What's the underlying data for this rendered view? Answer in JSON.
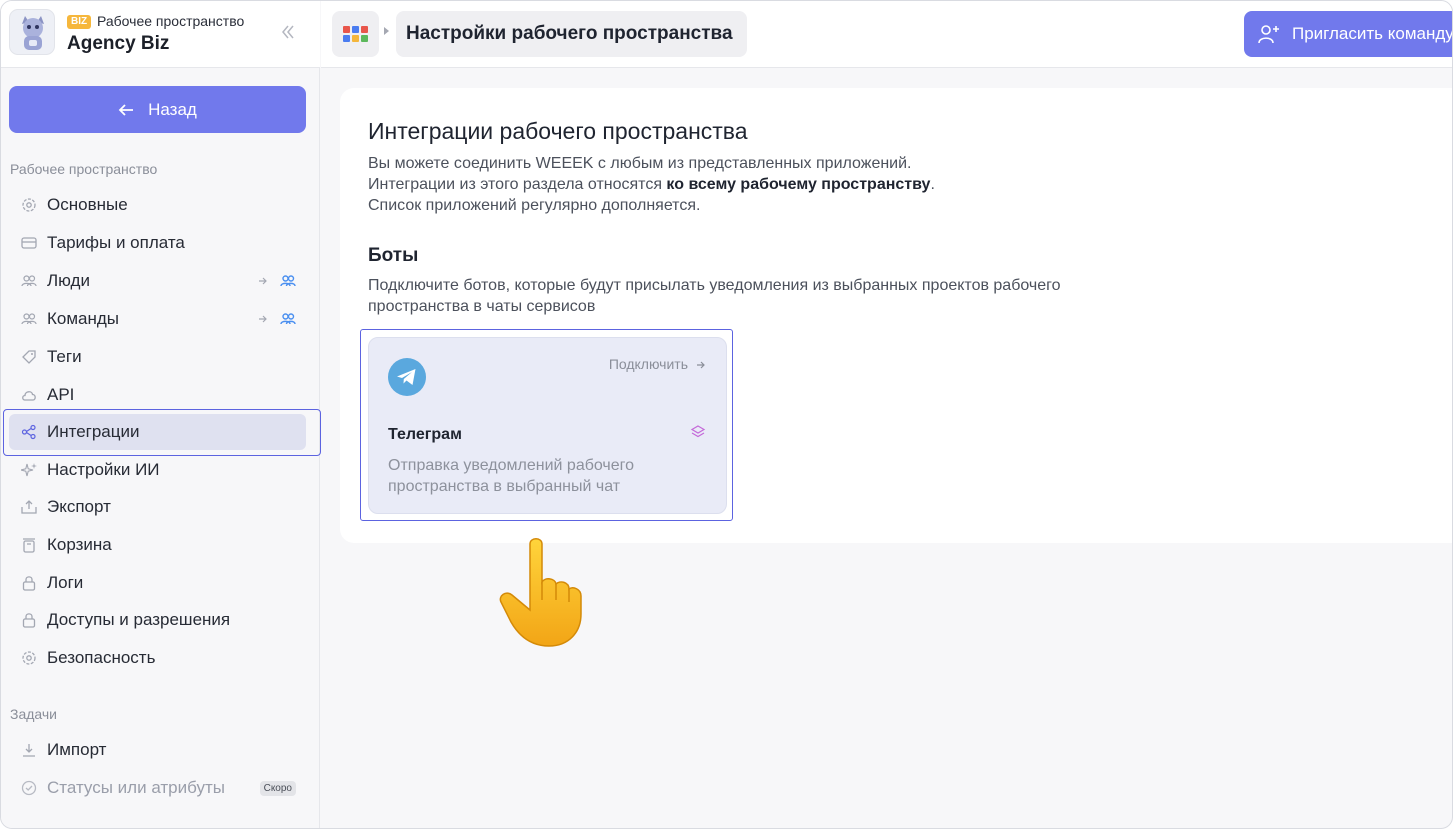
{
  "workspace": {
    "badge": "BIZ",
    "label": "Рабочее пространство",
    "name": "Agency Biz"
  },
  "sidebar": {
    "back_label": "Назад",
    "section_workspace": "Рабочее пространство",
    "workspace_items": [
      {
        "label": "Основные",
        "icon": "gear-icon"
      },
      {
        "label": "Тарифы и оплата",
        "icon": "card-icon"
      },
      {
        "label": "Люди",
        "icon": "people-icon"
      },
      {
        "label": "Команды",
        "icon": "people-icon"
      },
      {
        "label": "Теги",
        "icon": "tag-icon"
      },
      {
        "label": "API",
        "icon": "cloud-icon"
      },
      {
        "label": "Интеграции",
        "icon": "integration-icon"
      },
      {
        "label": "Настройки ИИ",
        "icon": "sparkle-icon"
      },
      {
        "label": "Экспорт",
        "icon": "export-icon"
      },
      {
        "label": "Корзина",
        "icon": "trash-icon"
      },
      {
        "label": "Логи",
        "icon": "lock-icon"
      },
      {
        "label": "Доступы и разрешения",
        "icon": "lock-icon"
      },
      {
        "label": "Безопасность",
        "icon": "gear-icon"
      }
    ],
    "section_tasks": "Задачи",
    "task_items": [
      {
        "label": "Импорт",
        "icon": "download-icon"
      },
      {
        "label": "Статусы или атрибуты",
        "icon": "check-circle-icon",
        "badge": "Скоро"
      }
    ],
    "active_item": "Интеграции"
  },
  "topbar": {
    "breadcrumb": "Настройки рабочего пространства",
    "invite_label": "Пригласить команду"
  },
  "main": {
    "title": "Интеграции рабочего пространства",
    "desc_line1": "Вы можете соединить WEEEK с любым из представленных приложений.",
    "desc_line2_pre": "Интеграции из этого раздела относятся ",
    "desc_line2_bold": "ко всему рабочему пространству",
    "desc_line2_post": ".",
    "desc_line3": "Список приложений регулярно дополняется.",
    "bots_title": "Боты",
    "bots_desc_line1": "Подключите ботов, которые будут присылать уведомления из выбранных проектов рабочего",
    "bots_desc_line2": "пространства в чаты сервисов",
    "integration": {
      "title": "Телеграм",
      "connect_label": "Подключить",
      "desc_line1": "Отправка уведомлений рабочего",
      "desc_line2": "пространства в выбранный чат"
    }
  },
  "colors": {
    "accent": "#7179ec",
    "active_bg": "#dfe1f0",
    "telegram": "#5aa8de"
  }
}
